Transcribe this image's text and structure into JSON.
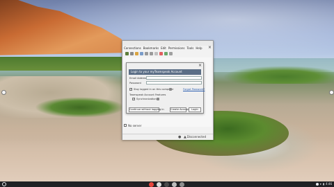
{
  "window": {
    "menu": [
      "Connections",
      "Bookmarks",
      "Edit",
      "Permissions",
      "Tools",
      "Help"
    ],
    "status_text": "No server",
    "bottom_status": "Disconnected"
  },
  "dialog": {
    "title": "Login to your myTeamspeak Account",
    "email_label": "Email Address",
    "password_label": "Password",
    "stay_logged_in": "Stay logged in on this computer",
    "forgot_password": "Forgot Password?",
    "features_label": "Teamspeak Account Features",
    "sync_label": "Synchronization",
    "continue_button": "Continue without logging in",
    "create_button": "Create Account",
    "login_button": "Login",
    "stay_checked": "✓",
    "sync_checked": "✓"
  },
  "shelf": {
    "time": "4:46",
    "apps": [
      {
        "name": "chrome",
        "color": "#e8453c"
      },
      {
        "name": "app-2",
        "color": "#dcdcdc"
      },
      {
        "name": "app-3",
        "color": "#4a4a4a"
      },
      {
        "name": "app-4",
        "color": "#bdbdbd"
      },
      {
        "name": "app-5",
        "color": "#8e8e8e"
      }
    ]
  }
}
